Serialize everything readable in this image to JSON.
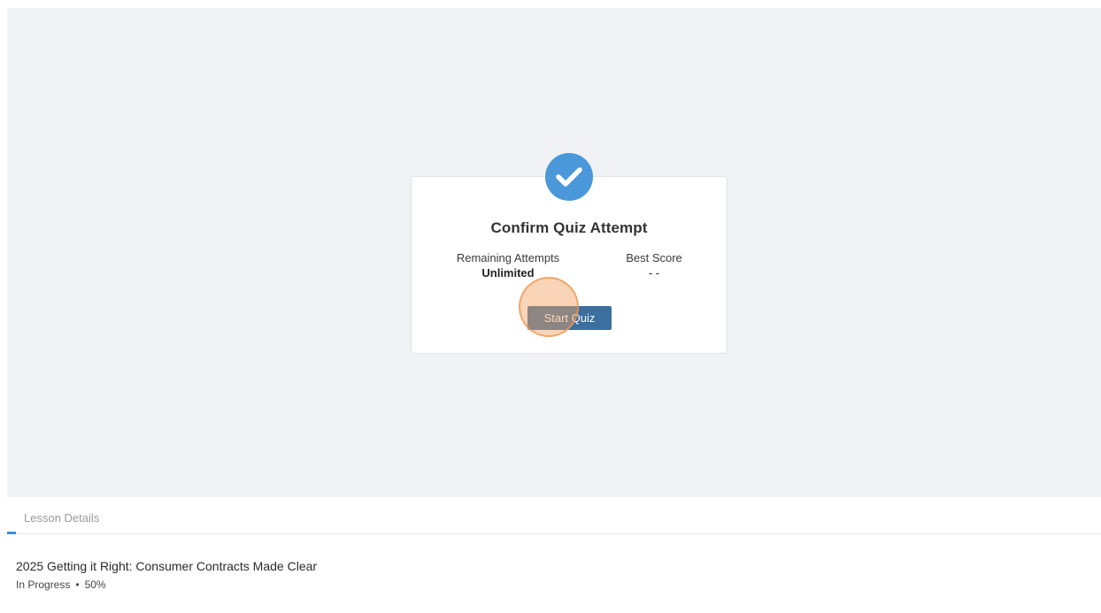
{
  "quiz": {
    "title": "Confirm Quiz Attempt",
    "remaining_attempts_label": "Remaining Attempts",
    "remaining_attempts_value": "Unlimited",
    "best_score_label": "Best Score",
    "best_score_value": "- -",
    "start_button_label": "Start Quiz"
  },
  "tabs": {
    "lesson_details_label": "Lesson Details"
  },
  "lesson": {
    "title": "2025 Getting it Right: Consumer Contracts Made Clear",
    "status": "In Progress",
    "separator": "•",
    "progress": "50%"
  },
  "colors": {
    "accent": "#4a98d9",
    "button": "#3a6f9f",
    "stage_background": "#f1f2f6",
    "click_highlight": "#f5a05f"
  },
  "icons": {
    "badge": "check-circle-icon"
  }
}
